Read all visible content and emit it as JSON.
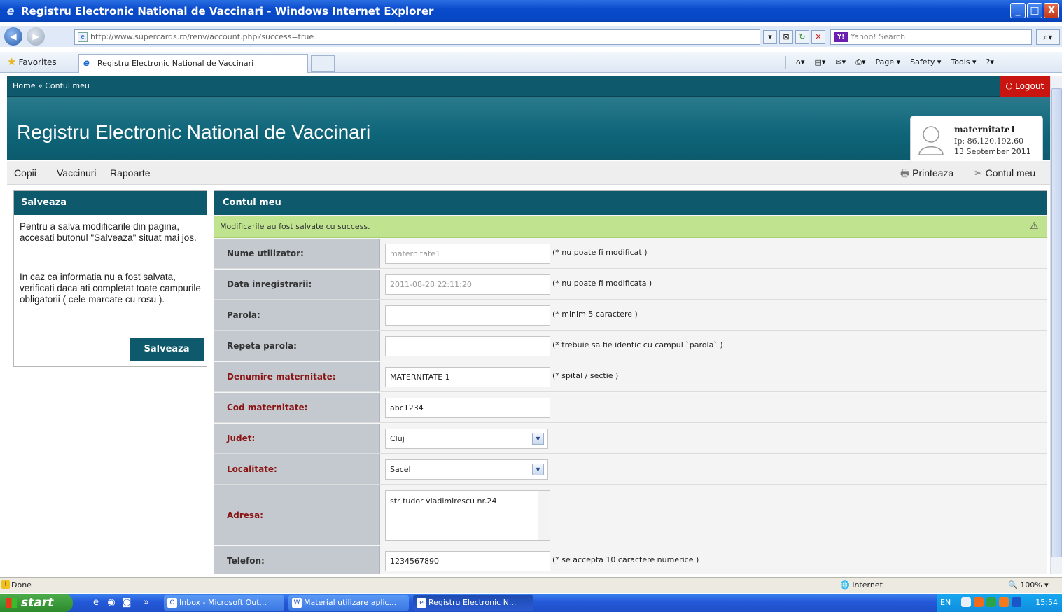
{
  "window": {
    "title": "Registru Electronic National de Vaccinari - Windows Internet Explorer",
    "controls": {
      "minimize": "_",
      "maximize": "□",
      "close": "X"
    }
  },
  "addressbar": {
    "url": "http://www.supercards.ro/renv/account.php?success=true",
    "search_placeholder": "Yahoo! Search",
    "yahoo_logo": "Y!"
  },
  "favbar": {
    "favorites_label": "Favorites",
    "tab_title": "Registru Electronic National de Vaccinari",
    "commands": [
      "Page ▾",
      "Safety ▾",
      "Tools ▾"
    ]
  },
  "site": {
    "breadcrumb": "Home » Contul meu",
    "logout": "Logout",
    "title": "Registru Electronic National de Vaccinari",
    "user": {
      "name": "maternitate1",
      "ip": "Ip: 86.120.192.60",
      "date": "13 September 2011"
    },
    "menu": [
      "Copii",
      "Vaccinuri",
      "Rapoarte"
    ],
    "print_label": "Printeaza",
    "account_label": "Contul meu"
  },
  "sidebox": {
    "title": "Salveaza",
    "paragraph1": "Pentru a salva modificarile din pagina, accesati butonul \"Salveaza\" situat mai jos.",
    "paragraph2": "In caz ca informatia nu a fost salvata, verificati daca ati completat toate campurile obligatorii ( cele marcate cu rosu ).",
    "button": "Salveaza"
  },
  "form": {
    "title": "Contul meu",
    "success": "Modificarile au fost salvate cu success.",
    "fields": {
      "username": {
        "label": "Nume utilizator:",
        "value": "maternitate1",
        "hint": "(* nu poate fi modificat )"
      },
      "regdate": {
        "label": "Data inregistrarii:",
        "value": "2011-08-28 22:11:20",
        "hint": "(* nu poate fi modificata )"
      },
      "password": {
        "label": "Parola:",
        "value": "",
        "hint": "(* minim 5 caractere )"
      },
      "password2": {
        "label": "Repeta parola:",
        "value": "",
        "hint": "(* trebuie sa fie identic cu campul `parola` )"
      },
      "maternity": {
        "label": "Denumire maternitate:",
        "value": "MATERNITATE 1",
        "hint": "(* spital / sectie )"
      },
      "code": {
        "label": "Cod maternitate:",
        "value": "abc1234"
      },
      "county": {
        "label": "Judet:",
        "value": "Cluj"
      },
      "locality": {
        "label": "Localitate:",
        "value": "Sacel"
      },
      "address": {
        "label": "Adresa:",
        "value": "str tudor vladimirescu nr.24"
      },
      "phone": {
        "label": "Telefon:",
        "value": "1234567890",
        "hint": "(* se accepta 10 caractere numerice )"
      }
    }
  },
  "statusbar": {
    "status": "Done",
    "zone": "Internet",
    "zoom": "100%"
  },
  "taskbar": {
    "start": "start",
    "windows": [
      "Inbox - Microsoft Out...",
      "Material utilizare aplic...",
      "Registru Electronic N..."
    ],
    "lang": "EN",
    "time": "15:54"
  }
}
